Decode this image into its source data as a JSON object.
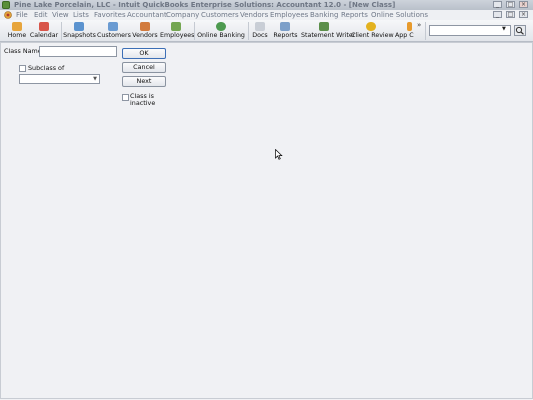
{
  "window": {
    "title": "Pine Lake Porcelain, LLC  - Intuit QuickBooks Enterprise Solutions: Accountant 12.0 - [New Class]",
    "controls": [
      "_",
      "□",
      "×",
      "_",
      "□",
      "×"
    ]
  },
  "menu": [
    "File",
    "Edit",
    "View",
    "Lists",
    "Favorites",
    "Accountant",
    "Company",
    "Customers",
    "Vendors",
    "Employees",
    "Banking",
    "Reports",
    "Online Solutions"
  ],
  "toolbar": {
    "items": [
      "Home",
      "Calendar",
      "Snapshots",
      "Customers",
      "Vendors",
      "Employees",
      "Online Banking",
      "Docs",
      "Reports",
      "Statement Writer",
      "Client Review",
      "App C"
    ],
    "overflow": "»",
    "search_arrow": "▼"
  },
  "form": {
    "class_name_label": "Class Name",
    "class_name_value": "",
    "subclass_label": "Subclass of",
    "subclass_value": "",
    "dropdown_arrow": "▼",
    "ok_label": "OK",
    "cancel_label": "Cancel",
    "next_label": "Next",
    "inactive_label_1": "Class is",
    "inactive_label_2": "inactive"
  },
  "colors": {
    "title_bar": "#b9c0ca",
    "background": "#f0f1f4",
    "menu_text": "#6f7888",
    "ok_border": "#3d6fb6"
  }
}
